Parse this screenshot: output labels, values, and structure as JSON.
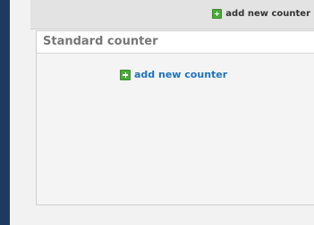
{
  "toolbar": {
    "add_label": "add new counter",
    "add_icon": "plus-icon"
  },
  "panel": {
    "title": "Standard counter",
    "add_label": "add new counter",
    "add_icon": "plus-icon"
  },
  "colors": {
    "rail": "#1f3a5f",
    "link_blue": "#1e73be",
    "icon_green": "#4ca93a"
  }
}
